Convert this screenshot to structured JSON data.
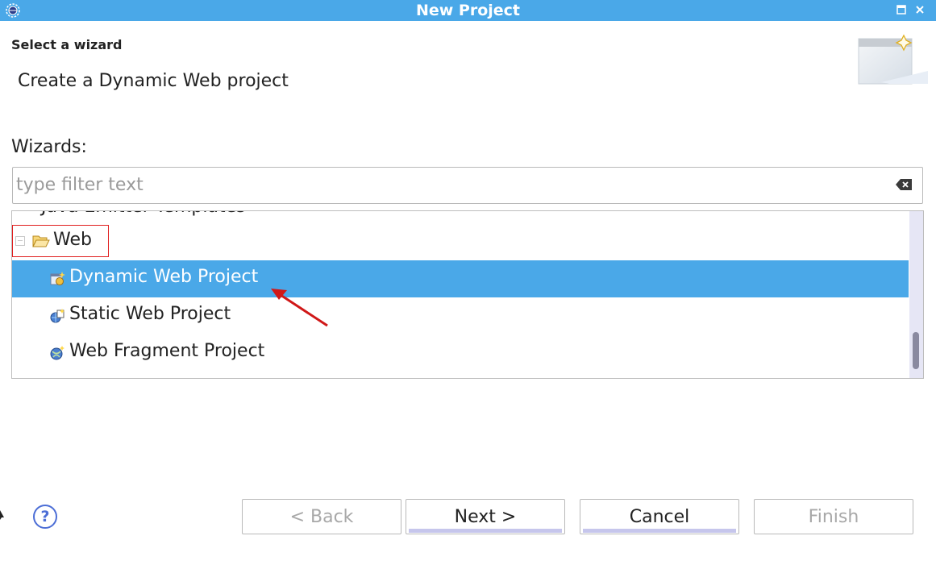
{
  "window": {
    "title": "New Project"
  },
  "header": {
    "title": "Select a wizard",
    "description": "Create a Dynamic Web project"
  },
  "wizards": {
    "label": "Wizards:",
    "filter_placeholder": "type filter text",
    "filter_value": ""
  },
  "tree": {
    "partial_row_label": "Java Emitter Templates",
    "category": {
      "label": "Web",
      "icon": "folder-open-icon",
      "expanded": true
    },
    "items": [
      {
        "label": "Dynamic Web Project",
        "icon": "dynamic-web-project-icon",
        "selected": true
      },
      {
        "label": "Static Web Project",
        "icon": "static-web-project-icon",
        "selected": false
      },
      {
        "label": "Web Fragment Project",
        "icon": "web-fragment-project-icon",
        "selected": false
      }
    ],
    "scroll_position": 0.9
  },
  "buttons": {
    "back": {
      "label": "< Back",
      "enabled": false
    },
    "next": {
      "label": "Next >",
      "enabled": true
    },
    "cancel": {
      "label": "Cancel",
      "enabled": true
    },
    "finish": {
      "label": "Finish",
      "enabled": false
    }
  },
  "colors": {
    "titlebar": "#4aa8e8",
    "selection": "#4aa8e8",
    "annotation": "#e02020"
  }
}
